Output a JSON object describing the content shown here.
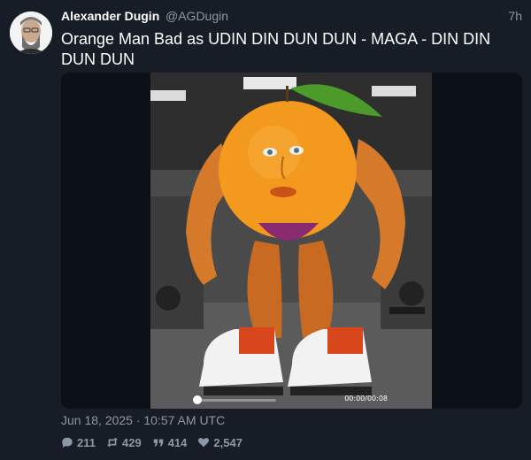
{
  "author": {
    "name": "Alexander Dugin",
    "handle": "@AGDugin",
    "time_ago": "7h"
  },
  "tweet": {
    "text": "Orange Man Bad as UDIN DIN DUN DUN - MAGA - DIN DIN DUN DUN",
    "date": "Jun 18, 2025 · 10:57 AM UTC"
  },
  "video": {
    "time_code": "00:00/00:08",
    "progress_fraction": 0.0
  },
  "stats": {
    "replies": "211",
    "retweets": "429",
    "quotes": "414",
    "likes": "2,547"
  },
  "icons": {
    "reply": "comment-icon",
    "retweet": "retweet-icon",
    "quote": "quote-icon",
    "like": "heart-icon"
  }
}
